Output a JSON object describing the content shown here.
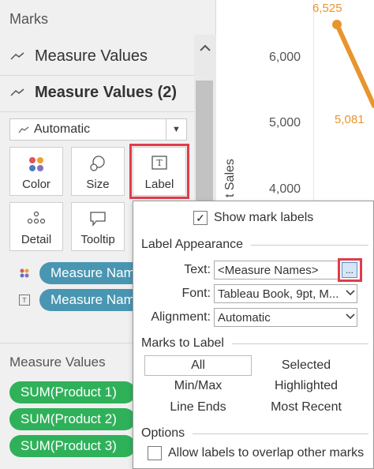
{
  "marks_panel": {
    "title": "Marks",
    "rows": [
      "Measure Values",
      "Measure Values (2)"
    ],
    "mark_type": "Automatic",
    "cards": {
      "color": "Color",
      "size": "Size",
      "label": "Label",
      "detail": "Detail",
      "tooltip": "Tooltip"
    },
    "pills": [
      "Measure Names",
      "Measure Names"
    ]
  },
  "measure_values": {
    "title": "Measure Values",
    "pills": [
      "SUM(Product 1)",
      "SUM(Product 2)",
      "SUM(Product 3)"
    ]
  },
  "chart": {
    "y_ticks": [
      "6,000",
      "5,000",
      "4,000"
    ],
    "y_label": "t Sales",
    "data_labels": [
      "6,525",
      "5,081"
    ],
    "line_color": "#e8952e"
  },
  "popup": {
    "show_mark_labels": "Show mark labels",
    "section_appearance": "Label Appearance",
    "text_label": "Text:",
    "text_value": "<Measure Names>",
    "ellipsis": "...",
    "font_label": "Font:",
    "font_value": "Tableau Book, 9pt, M...",
    "alignment_label": "Alignment:",
    "alignment_value": "Automatic",
    "section_marks": "Marks to Label",
    "marks_options": {
      "all": "All",
      "selected": "Selected",
      "minmax": "Min/Max",
      "highlighted": "Highlighted",
      "line_ends": "Line Ends",
      "most_recent": "Most Recent"
    },
    "section_options": "Options",
    "overlap": "Allow labels to overlap other marks"
  },
  "colors": {
    "highlight": "#e03c4a",
    "pill_blue": "#4996b2",
    "pill_green": "#2fb15a"
  }
}
